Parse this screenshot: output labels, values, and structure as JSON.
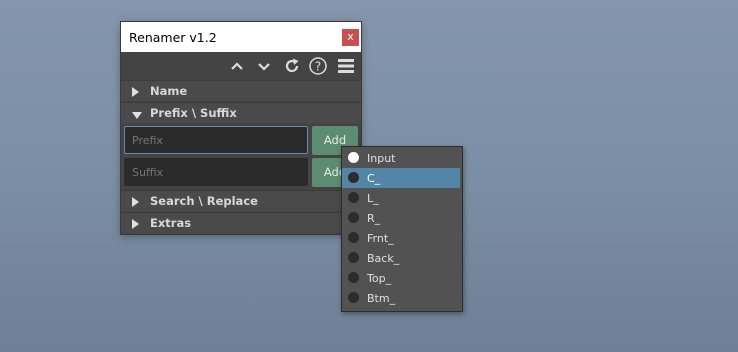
{
  "window": {
    "title": "Renamer v1.2",
    "close_label": "x"
  },
  "toolbar": {
    "icons": [
      "chevron-up-icon",
      "chevron-down-icon",
      "refresh-icon",
      "help-icon",
      "menu-icon"
    ],
    "help_glyph": "?"
  },
  "sections": {
    "name": "Name",
    "prefix_suffix": "Prefix \\ Suffix",
    "search_replace": "Search \\ Replace",
    "extras": "Extras"
  },
  "prefix": {
    "placeholder": "Prefix",
    "add_label": "Add"
  },
  "suffix": {
    "placeholder": "Suffix",
    "add_label": "Add"
  },
  "popup_menu": {
    "items": [
      "Input",
      "C_",
      "L_",
      "R_",
      "Frnt_",
      "Back_",
      "Top_",
      "Btm_"
    ],
    "selected_radio": "Input",
    "highlighted": "C_"
  },
  "colors": {
    "add_button": "#5c8c71",
    "highlight": "#5285a6",
    "close_button": "#c75050",
    "panel": "#444444"
  }
}
